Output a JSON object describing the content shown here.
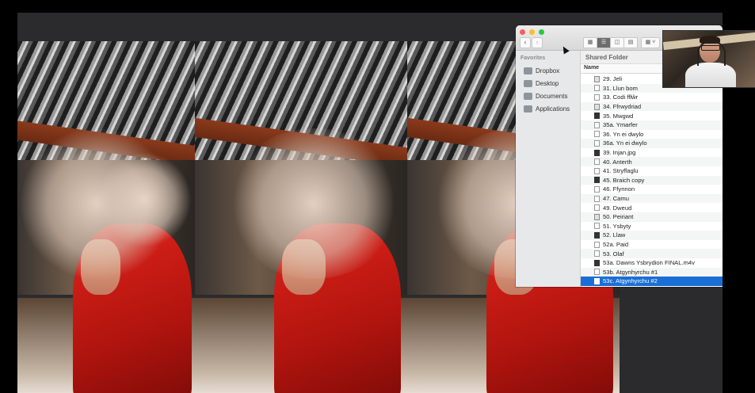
{
  "finder": {
    "favorites_header": "Favorites",
    "sidebar_items": [
      {
        "label": "Dropbox",
        "icon": "dropbox-icon"
      },
      {
        "label": "Desktop",
        "icon": "desktop-icon"
      },
      {
        "label": "Documents",
        "icon": "documents-icon"
      },
      {
        "label": "Applications",
        "icon": "applications-icon"
      }
    ],
    "path_title": "Shared Folder",
    "column_name": "Name",
    "view_buttons": [
      "icon-view",
      "list-view",
      "column-view",
      "gallery-view"
    ],
    "files": [
      {
        "name": "29. Jeli",
        "kind": "clip"
      },
      {
        "name": "31. Llun bom",
        "kind": "doc"
      },
      {
        "name": "33. Codi fflŵr",
        "kind": "doc"
      },
      {
        "name": "34. Ffrwydriad",
        "kind": "clip"
      },
      {
        "name": "35. Mwgwd",
        "kind": "dark"
      },
      {
        "name": "35a. Ymarfer",
        "kind": "doc"
      },
      {
        "name": "36. Yn ei dwylo",
        "kind": "doc"
      },
      {
        "name": "36a. Yn ei dwylo",
        "kind": "doc"
      },
      {
        "name": "39. Injan.jpg",
        "kind": "dark"
      },
      {
        "name": "40. Anterth",
        "kind": "doc"
      },
      {
        "name": "41. Stryffaglu",
        "kind": "doc"
      },
      {
        "name": "45. Braich copy",
        "kind": "dark"
      },
      {
        "name": "46. Ffynnon",
        "kind": "doc"
      },
      {
        "name": "47. Camu",
        "kind": "doc"
      },
      {
        "name": "49. Dweud",
        "kind": "doc"
      },
      {
        "name": "50. Peiriant",
        "kind": "clip"
      },
      {
        "name": "51. Ysbyty",
        "kind": "doc"
      },
      {
        "name": "52. Llaw",
        "kind": "dark"
      },
      {
        "name": "52a. Paid",
        "kind": "doc"
      },
      {
        "name": "53. Olaf",
        "kind": "doc"
      },
      {
        "name": "53a. Dawns Ysbrydion FINAL.m4v",
        "kind": "dark"
      },
      {
        "name": "53b. Atgynhyrchu #1",
        "kind": "doc"
      },
      {
        "name": "53c. Atgynhyrchu #2",
        "kind": "doc",
        "selected": true
      }
    ],
    "selected_color": "#1a6fd6"
  }
}
